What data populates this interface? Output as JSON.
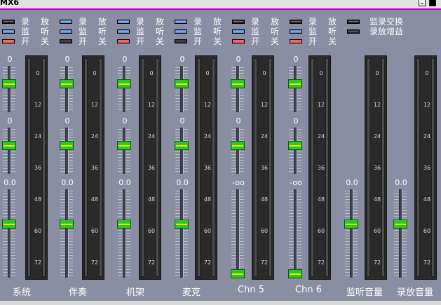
{
  "window": {
    "title": "MX6"
  },
  "controls": {
    "groups": [
      {
        "labels": [
          [
            "录",
            "放"
          ],
          [
            "监",
            "听"
          ],
          [
            "开",
            "关"
          ]
        ],
        "leds": [
          "dark",
          "blue",
          "red"
        ]
      },
      {
        "labels": [
          [
            "录",
            "放"
          ],
          [
            "监",
            "听"
          ],
          [
            "开",
            "关"
          ]
        ],
        "leds": [
          "blue",
          "blue",
          "dark"
        ]
      },
      {
        "labels": [
          [
            "录",
            "放"
          ],
          [
            "监",
            "听"
          ],
          [
            "开",
            "关"
          ]
        ],
        "leds": [
          "blue",
          "blue",
          "red"
        ]
      },
      {
        "labels": [
          [
            "录",
            "放"
          ],
          [
            "监",
            "听"
          ],
          [
            "开",
            "关"
          ]
        ],
        "leds": [
          "blue",
          "blue",
          "dark"
        ]
      },
      {
        "labels": [
          [
            "录",
            "放"
          ],
          [
            "监",
            "听"
          ],
          [
            "开",
            "关"
          ]
        ],
        "leds": [
          "dark",
          "blue",
          "red"
        ]
      },
      {
        "labels": [
          [
            "录",
            "放"
          ],
          [
            "监",
            "听"
          ],
          [
            "开",
            "关"
          ]
        ],
        "leds": [
          "dark",
          "blue",
          "red"
        ]
      }
    ],
    "right": [
      {
        "label": "监录交换",
        "led": "dark"
      },
      {
        "label": "录放增益",
        "led": "dark"
      }
    ]
  },
  "channels": [
    {
      "name": "系统",
      "values": [
        "0",
        "0",
        "0.0"
      ],
      "levels": [
        0.65,
        0.65,
        0.62
      ]
    },
    {
      "name": "伴奏",
      "values": [
        "0",
        "0",
        "0.0"
      ],
      "levels": [
        0.65,
        0.65,
        0.62
      ]
    },
    {
      "name": "机架",
      "values": [
        "0",
        "0",
        "0.0"
      ],
      "levels": [
        0.65,
        0.65,
        0.62
      ]
    },
    {
      "name": "麦克",
      "values": [
        "0",
        "0",
        "0.0"
      ],
      "levels": [
        0.65,
        0.65,
        0.62
      ]
    },
    {
      "name": "Chn 5",
      "values": [
        "0",
        "0",
        "-oo"
      ],
      "levels": [
        0.65,
        0.65,
        0.0
      ]
    },
    {
      "name": "Chn 6",
      "values": [
        "0",
        "0",
        "-oo"
      ],
      "levels": [
        0.65,
        0.65,
        0.0
      ]
    },
    {
      "name": "监听音量",
      "values": [
        "0.0"
      ],
      "levels": [
        0.62
      ]
    },
    {
      "name": "录放音量",
      "values": [
        "0.0"
      ],
      "levels": [
        0.62
      ]
    }
  ],
  "meter_scale": [
    "0",
    "12",
    "24",
    "36",
    "48",
    "60",
    "72"
  ],
  "colors": {
    "background": "#8a8ea2",
    "knob": "#28c828",
    "knob_line": "#f0e600",
    "led_blue": "#5e8fd8",
    "led_red": "#ea5a5a"
  }
}
